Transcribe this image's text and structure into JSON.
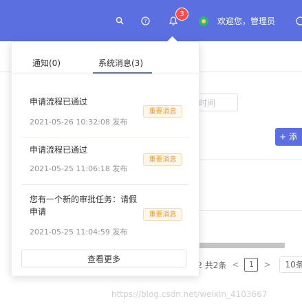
{
  "header": {
    "badge_count": "3",
    "welcome_text": "欢迎您，管理员",
    "bg_color": "#5b6fe0"
  },
  "icons": {
    "search": "search-icon",
    "help": "help-icon",
    "bell": "bell-icon",
    "avatar": "avatar-icon",
    "more": "more-icon"
  },
  "background": {
    "date_placeholder": "时间",
    "add_button": "+ 添",
    "pagination_total": "-2 共2条",
    "pagination_current": "1",
    "pagination_size": "10条",
    "watermark": "https://blog.csdn.net/weixin_4103667"
  },
  "popover": {
    "tabs": [
      {
        "label": "通知(0)"
      },
      {
        "label": "系统消息(3)"
      }
    ],
    "messages": [
      {
        "title": "申请流程已通过",
        "time": "2021-05-26 10:32:08 发布",
        "tag": "重要消息"
      },
      {
        "title": "申请流程已通过",
        "time": "2021-05-25 11:06:18 发布",
        "tag": "重要消息"
      },
      {
        "title": "您有一个新的审批任务：请假申请",
        "time": "2021-05-25 11:04:59 发布",
        "tag": "重要消息"
      }
    ],
    "view_more": "查看更多"
  }
}
